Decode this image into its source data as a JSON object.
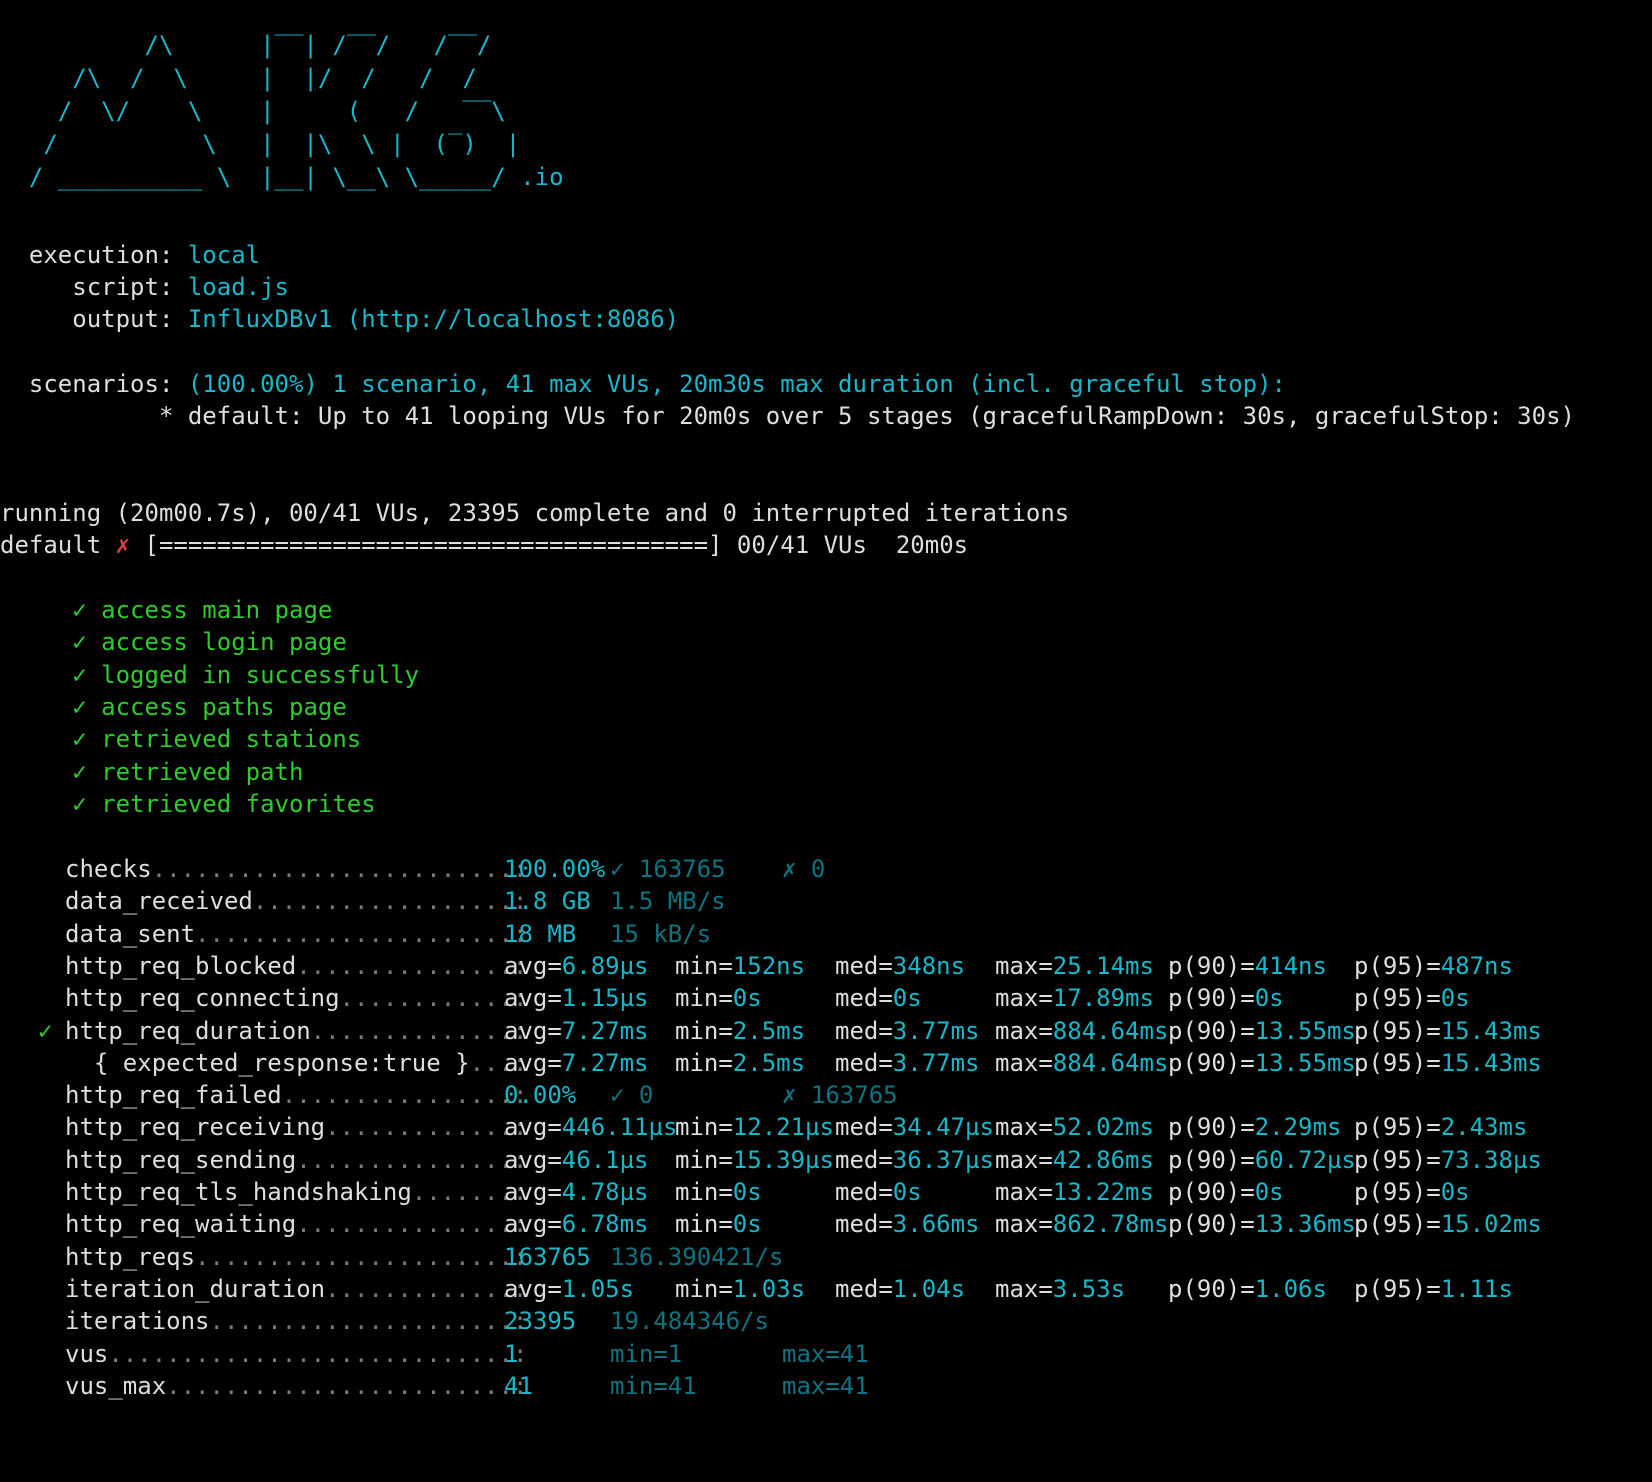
{
  "banner": [
    "          /\\      |‾‾| /‾‾/   /‾‾/",
    "     /\\  /  \\     |  |/  /   /  /",
    "    /  \\/    \\    |     (   /   ‾‾\\",
    "   /          \\   |  |\\  \\ |  (‾)  |",
    "  / __________ \\  |__| \\__\\ \\_____/ .io"
  ],
  "info": [
    {
      "label": "  execution: ",
      "value": "local"
    },
    {
      "label": "     script: ",
      "value": "load.js"
    },
    {
      "label": "     output: ",
      "value": "InfluxDBv1 (http://localhost:8086)"
    }
  ],
  "scenarios": {
    "label": "  scenarios: ",
    "summary": "(100.00%) 1 scenario, 41 max VUs, 20m30s max duration (incl. graceful stop):",
    "detail": "           * default: Up to 41 looping VUs for 20m0s over 5 stages (gracefulRampDown: 30s, gracefulStop: 30s)"
  },
  "running": "running (20m00.7s), 00/41 VUs, 23395 complete and 0 interrupted iterations",
  "progress": {
    "name": "default ",
    "mark": "✗",
    "bar": " [======================================] 00/41 VUs  20m0s"
  },
  "checks": [
    "access main page",
    "access login page",
    "logged in successfully",
    "access paths page",
    "retrieved stations",
    "retrieved path",
    "retrieved favorites"
  ],
  "check_mark": "✓",
  "metrics": [
    {
      "prefix": "",
      "name": "checks",
      "dots": ".........................:",
      "cols": [
        {
          "t": "100.00%",
          "c": "cy"
        },
        {
          "t": "✓ 163765",
          "c": "dc"
        },
        {
          "t": "✗ 0",
          "c": "dc"
        }
      ]
    },
    {
      "prefix": "",
      "name": "data_received",
      "dots": "..................:",
      "cols": [
        {
          "t": "1.8 GB",
          "c": "cy"
        },
        {
          "t": "1.5 MB/s",
          "c": "dc"
        }
      ]
    },
    {
      "prefix": "",
      "name": "data_sent",
      "dots": "......................:",
      "cols": [
        {
          "t": "18 MB",
          "c": "cy"
        },
        {
          "t": "15 kB/s",
          "c": "dc"
        }
      ]
    },
    {
      "prefix": "",
      "name": "http_req_blocked",
      "dots": "...............:",
      "stats": [
        [
          "avg=",
          "6.89µs"
        ],
        [
          "min=",
          "152ns"
        ],
        [
          "med=",
          "348ns"
        ],
        [
          "max=",
          "25.14ms"
        ],
        [
          "p(90)=",
          "414ns"
        ],
        [
          "p(95)=",
          "487ns"
        ]
      ]
    },
    {
      "prefix": "",
      "name": "http_req_connecting",
      "dots": "............:",
      "stats": [
        [
          "avg=",
          "1.15µs"
        ],
        [
          "min=",
          "0s"
        ],
        [
          "med=",
          "0s"
        ],
        [
          "max=",
          "17.89ms"
        ],
        [
          "p(90)=",
          "0s"
        ],
        [
          "p(95)=",
          "0s"
        ]
      ]
    },
    {
      "prefix": "✓",
      "name": "http_req_duration",
      "dots": "..............:",
      "stats": [
        [
          "avg=",
          "7.27ms"
        ],
        [
          "min=",
          "2.5ms"
        ],
        [
          "med=",
          "3.77ms"
        ],
        [
          "max=",
          "884.64ms"
        ],
        [
          "p(90)=",
          "13.55ms"
        ],
        [
          "p(95)=",
          "15.43ms"
        ]
      ]
    },
    {
      "prefix": "",
      "name": "  { expected_response:true }",
      "dots": "...:",
      "stats": [
        [
          "avg=",
          "7.27ms"
        ],
        [
          "min=",
          "2.5ms"
        ],
        [
          "med=",
          "3.77ms"
        ],
        [
          "max=",
          "884.64ms"
        ],
        [
          "p(90)=",
          "13.55ms"
        ],
        [
          "p(95)=",
          "15.43ms"
        ]
      ]
    },
    {
      "prefix": "",
      "name": "http_req_failed",
      "dots": "................:",
      "cols": [
        {
          "t": "0.00%",
          "c": "cy"
        },
        {
          "t": "✓ 0",
          "c": "dc"
        },
        {
          "t": "✗ 163765",
          "c": "dc"
        }
      ]
    },
    {
      "prefix": "",
      "name": "http_req_receiving",
      "dots": ".............:",
      "stats": [
        [
          "avg=",
          "446.11µs"
        ],
        [
          "min=",
          "12.21µs"
        ],
        [
          "med=",
          "34.47µs"
        ],
        [
          "max=",
          "52.02ms"
        ],
        [
          "p(90)=",
          "2.29ms"
        ],
        [
          "p(95)=",
          "2.43ms"
        ]
      ]
    },
    {
      "prefix": "",
      "name": "http_req_sending",
      "dots": "...............:",
      "stats": [
        [
          "avg=",
          "46.1µs"
        ],
        [
          "min=",
          "15.39µs"
        ],
        [
          "med=",
          "36.37µs"
        ],
        [
          "max=",
          "42.86ms"
        ],
        [
          "p(90)=",
          "60.72µs"
        ],
        [
          "p(95)=",
          "73.38µs"
        ]
      ]
    },
    {
      "prefix": "",
      "name": "http_req_tls_handshaking",
      "dots": ".......:",
      "stats": [
        [
          "avg=",
          "4.78µs"
        ],
        [
          "min=",
          "0s"
        ],
        [
          "med=",
          "0s"
        ],
        [
          "max=",
          "13.22ms"
        ],
        [
          "p(90)=",
          "0s"
        ],
        [
          "p(95)=",
          "0s"
        ]
      ]
    },
    {
      "prefix": "",
      "name": "http_req_waiting",
      "dots": "...............:",
      "stats": [
        [
          "avg=",
          "6.78ms"
        ],
        [
          "min=",
          "0s"
        ],
        [
          "med=",
          "3.66ms"
        ],
        [
          "max=",
          "862.78ms"
        ],
        [
          "p(90)=",
          "13.36ms"
        ],
        [
          "p(95)=",
          "15.02ms"
        ]
      ]
    },
    {
      "prefix": "",
      "name": "http_reqs",
      "dots": "......................:",
      "cols": [
        {
          "t": "163765",
          "c": "cy"
        },
        {
          "t": "136.390421/s",
          "c": "dc"
        }
      ]
    },
    {
      "prefix": "",
      "name": "iteration_duration",
      "dots": ".............:",
      "stats": [
        [
          "avg=",
          "1.05s"
        ],
        [
          "min=",
          "1.03s"
        ],
        [
          "med=",
          "1.04s"
        ],
        [
          "max=",
          "3.53s"
        ],
        [
          "p(90)=",
          "1.06s"
        ],
        [
          "p(95)=",
          "1.11s"
        ]
      ]
    },
    {
      "prefix": "",
      "name": "iterations",
      "dots": ".....................:",
      "cols": [
        {
          "t": "23395",
          "c": "cy"
        },
        {
          "t": "19.484346/s",
          "c": "dc"
        }
      ]
    },
    {
      "prefix": "",
      "name": "vus",
      "dots": "............................:",
      "cols": [
        {
          "t": "1",
          "c": "cy"
        },
        {
          "t": "min=1",
          "c": "dc"
        },
        {
          "t": "max=41",
          "c": "dc"
        }
      ]
    },
    {
      "prefix": "",
      "name": "vus_max",
      "dots": "........................:",
      "cols": [
        {
          "t": "41",
          "c": "cy"
        },
        {
          "t": "min=41",
          "c": "dc"
        },
        {
          "t": "max=41",
          "c": "dc"
        }
      ]
    }
  ]
}
